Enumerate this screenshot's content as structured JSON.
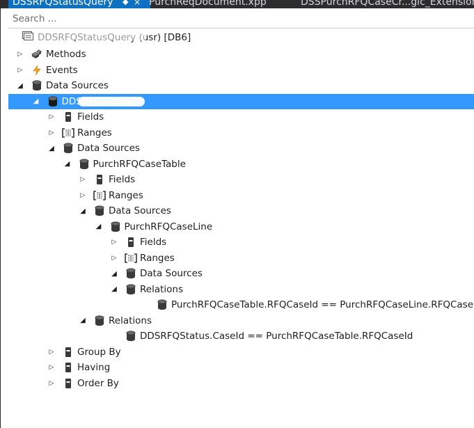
{
  "tabs": [
    {
      "label": "DSSRFQStatusQuery",
      "active": true
    },
    {
      "label": "PurchReqDocument.xpp",
      "active": false
    },
    {
      "label": "DSSPurchRFQCaseCr...gic_Extension.xp",
      "active": false
    }
  ],
  "search": {
    "placeholder": "Search ..."
  },
  "root": {
    "label": "DDSRFQStatusQuery (usr) [DB6]"
  },
  "tree": [
    {
      "depth": 0,
      "icon": "methods",
      "label": "Methods",
      "expanded": false
    },
    {
      "depth": 0,
      "icon": "events",
      "label": "Events",
      "expanded": false
    },
    {
      "depth": 0,
      "icon": "datasource",
      "label": "Data Sources",
      "expanded": true
    },
    {
      "depth": 1,
      "icon": "datasource",
      "label": "DDSRFQStatus",
      "expanded": true,
      "selected": true,
      "redacted": true
    },
    {
      "depth": 2,
      "icon": "fields",
      "label": "Fields",
      "expanded": false
    },
    {
      "depth": 2,
      "icon": "ranges",
      "label": "Ranges",
      "expanded": false
    },
    {
      "depth": 2,
      "icon": "datasource",
      "label": "Data Sources",
      "expanded": true
    },
    {
      "depth": 3,
      "icon": "datasource",
      "label": "PurchRFQCaseTable",
      "expanded": true
    },
    {
      "depth": 4,
      "icon": "fields",
      "label": "Fields",
      "expanded": false
    },
    {
      "depth": 4,
      "icon": "ranges",
      "label": "Ranges",
      "expanded": false
    },
    {
      "depth": 4,
      "icon": "datasource",
      "label": "Data Sources",
      "expanded": true
    },
    {
      "depth": 5,
      "icon": "datasource",
      "label": "PurchRFQCaseLine",
      "expanded": true
    },
    {
      "depth": 6,
      "icon": "fields",
      "label": "Fields",
      "expanded": false
    },
    {
      "depth": 6,
      "icon": "ranges",
      "label": "Ranges",
      "expanded": false
    },
    {
      "depth": 6,
      "icon": "datasource",
      "label": "Data Sources",
      "expanded": true
    },
    {
      "depth": 6,
      "icon": "datasource",
      "label": "Relations",
      "expanded": true
    },
    {
      "depth": 8,
      "icon": "datasource",
      "label": "PurchRFQCaseTable.RFQCaseId == PurchRFQCaseLine.RFQCaseId"
    },
    {
      "depth": 4,
      "icon": "datasource",
      "label": "Relations",
      "expanded": true
    },
    {
      "depth": 6,
      "icon": "datasource",
      "label": "DDSRFQStatus.CaseId == PurchRFQCaseTable.RFQCaseId"
    },
    {
      "depth": 2,
      "icon": "fields",
      "label": "Group By",
      "expanded": false
    },
    {
      "depth": 2,
      "icon": "fields",
      "label": "Having",
      "expanded": false
    },
    {
      "depth": 2,
      "icon": "fields",
      "label": "Order By",
      "expanded": false
    }
  ]
}
